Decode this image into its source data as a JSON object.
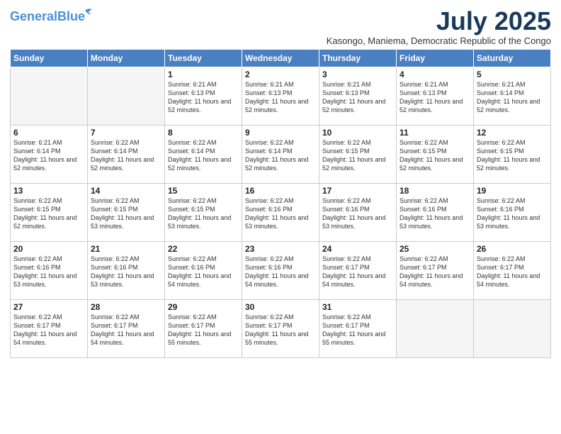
{
  "logo": {
    "line1": "General",
    "line2": "Blue"
  },
  "title": "July 2025",
  "location": "Kasongo, Maniema, Democratic Republic of the Congo",
  "days_of_week": [
    "Sunday",
    "Monday",
    "Tuesday",
    "Wednesday",
    "Thursday",
    "Friday",
    "Saturday"
  ],
  "weeks": [
    [
      {
        "num": "",
        "info": ""
      },
      {
        "num": "",
        "info": ""
      },
      {
        "num": "1",
        "info": "Sunrise: 6:21 AM\nSunset: 6:13 PM\nDaylight: 11 hours and 52 minutes."
      },
      {
        "num": "2",
        "info": "Sunrise: 6:21 AM\nSunset: 6:13 PM\nDaylight: 11 hours and 52 minutes."
      },
      {
        "num": "3",
        "info": "Sunrise: 6:21 AM\nSunset: 6:13 PM\nDaylight: 11 hours and 52 minutes."
      },
      {
        "num": "4",
        "info": "Sunrise: 6:21 AM\nSunset: 6:13 PM\nDaylight: 11 hours and 52 minutes."
      },
      {
        "num": "5",
        "info": "Sunrise: 6:21 AM\nSunset: 6:14 PM\nDaylight: 11 hours and 52 minutes."
      }
    ],
    [
      {
        "num": "6",
        "info": "Sunrise: 6:21 AM\nSunset: 6:14 PM\nDaylight: 11 hours and 52 minutes."
      },
      {
        "num": "7",
        "info": "Sunrise: 6:22 AM\nSunset: 6:14 PM\nDaylight: 11 hours and 52 minutes."
      },
      {
        "num": "8",
        "info": "Sunrise: 6:22 AM\nSunset: 6:14 PM\nDaylight: 11 hours and 52 minutes."
      },
      {
        "num": "9",
        "info": "Sunrise: 6:22 AM\nSunset: 6:14 PM\nDaylight: 11 hours and 52 minutes."
      },
      {
        "num": "10",
        "info": "Sunrise: 6:22 AM\nSunset: 6:15 PM\nDaylight: 11 hours and 52 minutes."
      },
      {
        "num": "11",
        "info": "Sunrise: 6:22 AM\nSunset: 6:15 PM\nDaylight: 11 hours and 52 minutes."
      },
      {
        "num": "12",
        "info": "Sunrise: 6:22 AM\nSunset: 6:15 PM\nDaylight: 11 hours and 52 minutes."
      }
    ],
    [
      {
        "num": "13",
        "info": "Sunrise: 6:22 AM\nSunset: 6:15 PM\nDaylight: 11 hours and 52 minutes."
      },
      {
        "num": "14",
        "info": "Sunrise: 6:22 AM\nSunset: 6:15 PM\nDaylight: 11 hours and 53 minutes."
      },
      {
        "num": "15",
        "info": "Sunrise: 6:22 AM\nSunset: 6:15 PM\nDaylight: 11 hours and 53 minutes."
      },
      {
        "num": "16",
        "info": "Sunrise: 6:22 AM\nSunset: 6:16 PM\nDaylight: 11 hours and 53 minutes."
      },
      {
        "num": "17",
        "info": "Sunrise: 6:22 AM\nSunset: 6:16 PM\nDaylight: 11 hours and 53 minutes."
      },
      {
        "num": "18",
        "info": "Sunrise: 6:22 AM\nSunset: 6:16 PM\nDaylight: 11 hours and 53 minutes."
      },
      {
        "num": "19",
        "info": "Sunrise: 6:22 AM\nSunset: 6:16 PM\nDaylight: 11 hours and 53 minutes."
      }
    ],
    [
      {
        "num": "20",
        "info": "Sunrise: 6:22 AM\nSunset: 6:16 PM\nDaylight: 11 hours and 53 minutes."
      },
      {
        "num": "21",
        "info": "Sunrise: 6:22 AM\nSunset: 6:16 PM\nDaylight: 11 hours and 53 minutes."
      },
      {
        "num": "22",
        "info": "Sunrise: 6:22 AM\nSunset: 6:16 PM\nDaylight: 11 hours and 54 minutes."
      },
      {
        "num": "23",
        "info": "Sunrise: 6:22 AM\nSunset: 6:16 PM\nDaylight: 11 hours and 54 minutes."
      },
      {
        "num": "24",
        "info": "Sunrise: 6:22 AM\nSunset: 6:17 PM\nDaylight: 11 hours and 54 minutes."
      },
      {
        "num": "25",
        "info": "Sunrise: 6:22 AM\nSunset: 6:17 PM\nDaylight: 11 hours and 54 minutes."
      },
      {
        "num": "26",
        "info": "Sunrise: 6:22 AM\nSunset: 6:17 PM\nDaylight: 11 hours and 54 minutes."
      }
    ],
    [
      {
        "num": "27",
        "info": "Sunrise: 6:22 AM\nSunset: 6:17 PM\nDaylight: 11 hours and 54 minutes."
      },
      {
        "num": "28",
        "info": "Sunrise: 6:22 AM\nSunset: 6:17 PM\nDaylight: 11 hours and 54 minutes."
      },
      {
        "num": "29",
        "info": "Sunrise: 6:22 AM\nSunset: 6:17 PM\nDaylight: 11 hours and 55 minutes."
      },
      {
        "num": "30",
        "info": "Sunrise: 6:22 AM\nSunset: 6:17 PM\nDaylight: 11 hours and 55 minutes."
      },
      {
        "num": "31",
        "info": "Sunrise: 6:22 AM\nSunset: 6:17 PM\nDaylight: 11 hours and 55 minutes."
      },
      {
        "num": "",
        "info": ""
      },
      {
        "num": "",
        "info": ""
      }
    ]
  ]
}
